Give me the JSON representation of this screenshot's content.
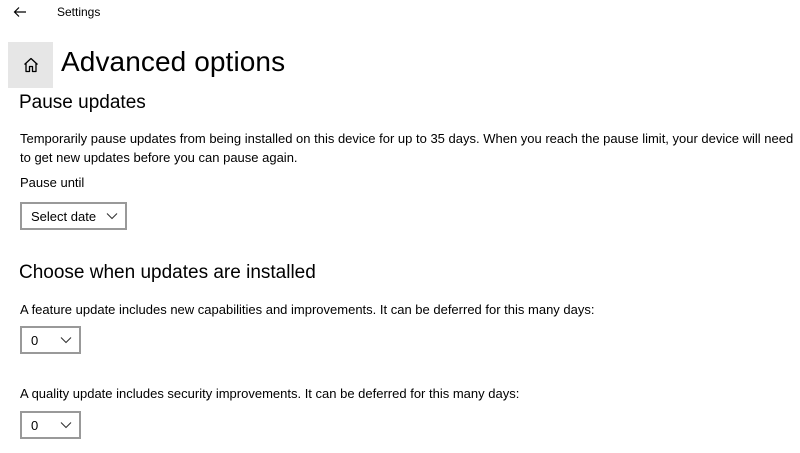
{
  "window": {
    "app_title": "Settings"
  },
  "header": {
    "page_title": "Advanced options"
  },
  "pause_updates": {
    "heading": "Pause updates",
    "description": "Temporarily pause updates from being installed on this device for up to 35 days. When you reach the pause limit, your device will need to get new updates before you can pause again.",
    "pause_until_label": "Pause until",
    "pause_until_value": "Select date"
  },
  "choose_when": {
    "heading": "Choose when updates are installed",
    "feature_update_label": "A feature update includes new capabilities and improvements. It can be deferred for this many days:",
    "feature_update_value": "0",
    "quality_update_label": "A quality update includes security improvements. It can be deferred for this many days:",
    "quality_update_value": "0"
  },
  "icons": {
    "back": "back-arrow-icon",
    "home": "home-icon",
    "dropdown": "chevron-down-icon"
  }
}
